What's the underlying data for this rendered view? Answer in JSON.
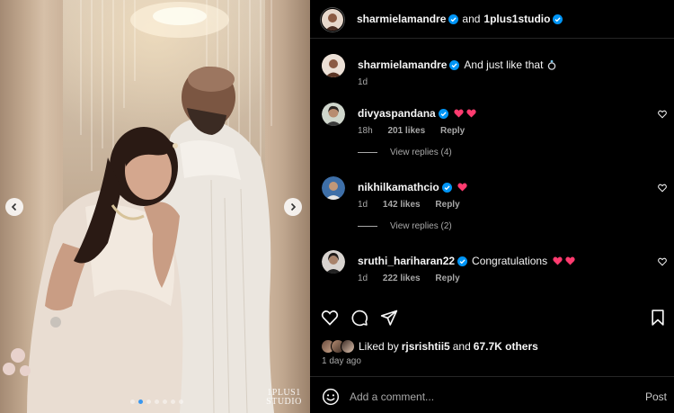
{
  "photo": {
    "watermark_line1": "1PLUS1",
    "watermark_line2": "STUDIO",
    "carousel": {
      "total": 7,
      "active": 1
    }
  },
  "header": {
    "author": "sharmielamandre",
    "conjunction": "and",
    "collaborator": "1plus1studio"
  },
  "comments": [
    {
      "user": "sharmielamandre",
      "verified": true,
      "text": "And just like that",
      "emoji": "ring",
      "time": "1d",
      "likes": "",
      "reply": "",
      "is_caption": true
    },
    {
      "user": "divyaspandana",
      "verified": true,
      "text": "",
      "emoji": "two-hearts",
      "time": "18h",
      "likes": "201 likes",
      "reply": "Reply",
      "view_replies": "View replies (4)"
    },
    {
      "user": "nikhilkamathcio",
      "verified": true,
      "text": "",
      "emoji": "one-heart",
      "time": "1d",
      "likes": "142 likes",
      "reply": "Reply",
      "view_replies": "View replies (2)"
    },
    {
      "user": "sruthi_hariharan22",
      "verified": true,
      "text": "Congratulations",
      "emoji": "two-hearts",
      "time": "1d",
      "likes": "222 likes",
      "reply": "Reply"
    }
  ],
  "likes": {
    "prefix": "Liked by",
    "user": "rjsrishtii5",
    "mid": "and",
    "count": "67.7K others"
  },
  "timestamp": "1 day ago",
  "add_comment": {
    "placeholder": "Add a comment...",
    "post_label": "Post"
  },
  "colors": {
    "background": "#000000",
    "verified_blue": "#0095f6",
    "heart_pink": "#ff3b6f",
    "muted_text": "#a8a8a8"
  }
}
